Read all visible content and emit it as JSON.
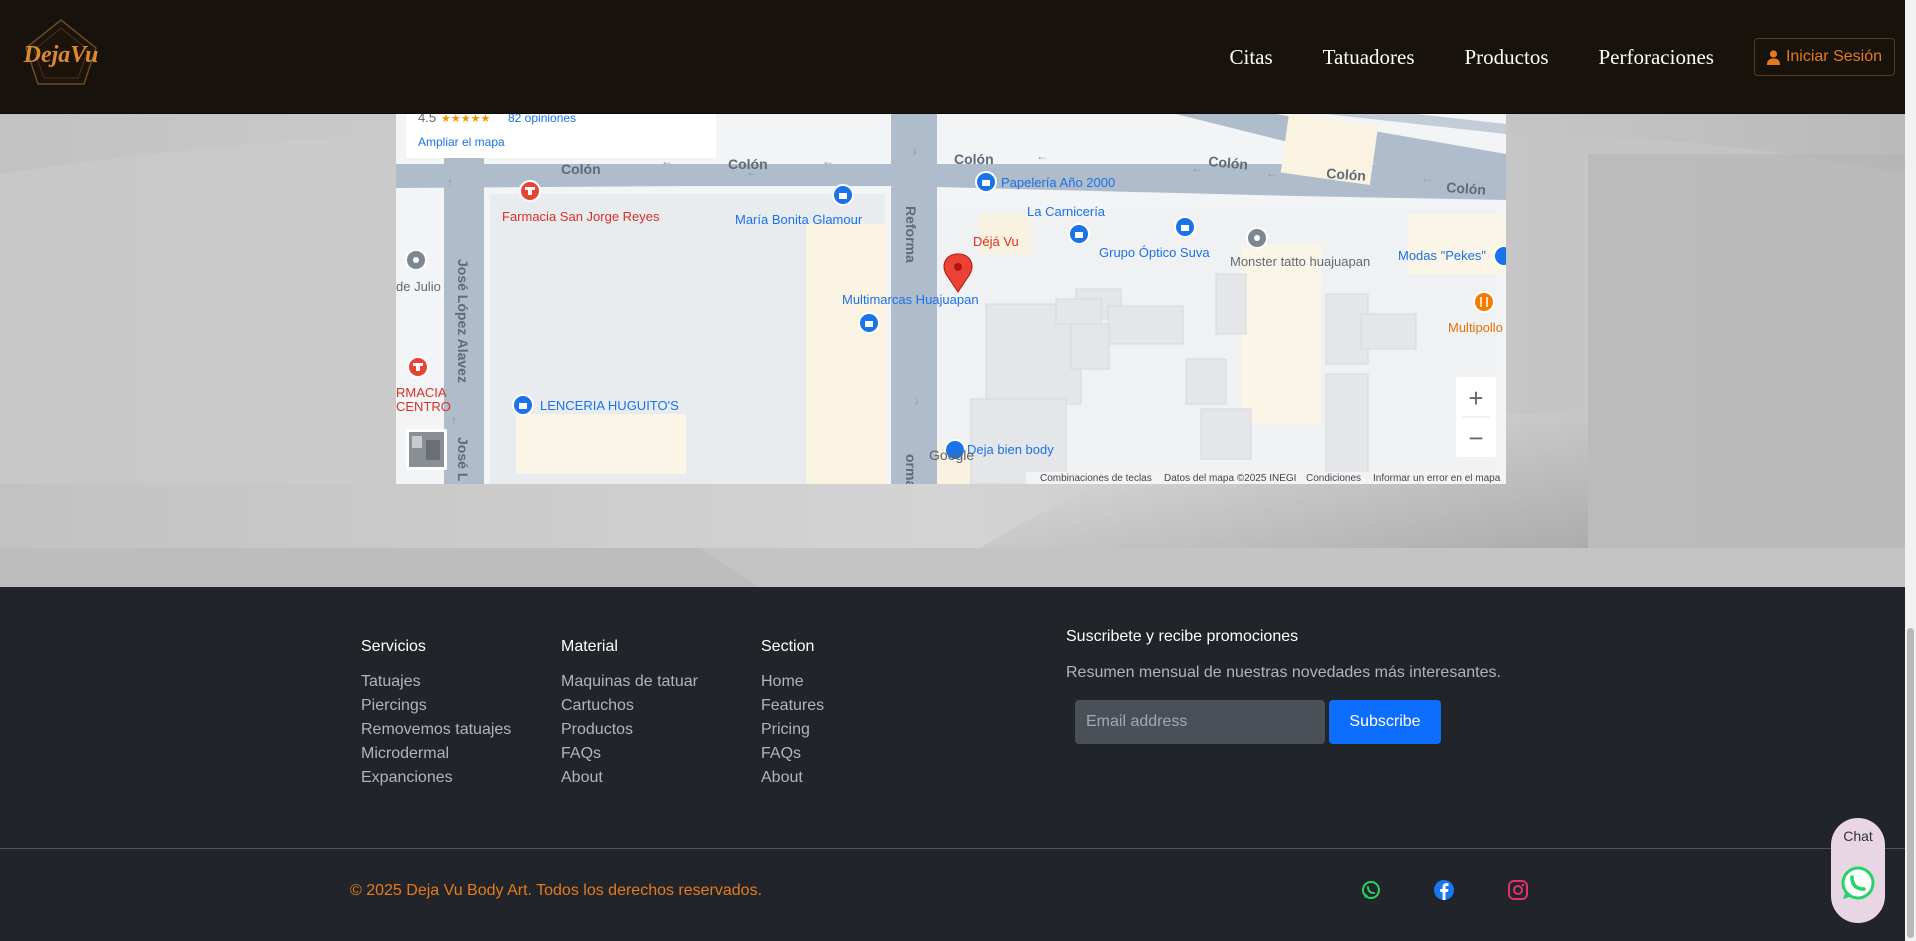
{
  "brand": {
    "logo_text": "DejaVu"
  },
  "nav": {
    "links": [
      "Citas",
      "Tatuadores",
      "Productos",
      "Perforaciones"
    ],
    "login_label": "Iniciar Sesión"
  },
  "map": {
    "info_rating": "4.5",
    "info_reviews": "82 opiniones",
    "info_enlarge": "Ampliar el mapa",
    "streets": {
      "colon": "Colón",
      "reforma": "Reforma",
      "jose_lopez": "José López Alavez",
      "jose_l": "José L",
      "de_julio": "de Julio",
      "reforma2": "orma"
    },
    "places": {
      "farmacia_sjr": "Farmacia San Jorge Reyes",
      "maria_bonita": "María Bonita Glamour",
      "papeleria": "Papelería Año 2000",
      "carniceria": "La Carnicería",
      "deja_vu": "Déjá Vu",
      "grupo_optico": "Grupo Óptico Suva",
      "monster": "Monster tatto huajuapan",
      "modas": "Modas \"Pekes\"",
      "multimarcas": "Multimarcas Huajuapan",
      "multipollo": "Multipollo",
      "farmacia_centro_1": "RMACIA",
      "farmacia_centro_2": "CENTRO",
      "lenceria": "LENCERIA HUGUITO'S",
      "deja_bien": "Deja bien body"
    },
    "google": "Google",
    "attribution": {
      "shortcuts": "Combinaciones de teclas",
      "data": "Datos del mapa ©2025 INEGI",
      "terms": "Condiciones",
      "report": "Informar un error en el mapa"
    },
    "zoom_in": "+",
    "zoom_out": "−"
  },
  "footer": {
    "columns": [
      {
        "title": "Servicios",
        "links": [
          "Tatuajes",
          "Piercings",
          "Removemos tatuajes",
          "Microdermal",
          "Expanciones"
        ]
      },
      {
        "title": "Material",
        "links": [
          "Maquinas de tatuar",
          "Cartuchos",
          "Productos",
          "FAQs",
          "About"
        ]
      },
      {
        "title": "Section",
        "links": [
          "Home",
          "Features",
          "Pricing",
          "FAQs",
          "About"
        ]
      }
    ],
    "newsletter": {
      "title": "Suscribete y recibe promociones",
      "description": "Resumen mensual de nuestras novedades más interesantes.",
      "placeholder": "Email address",
      "button": "Subscribe"
    },
    "copyright": "© 2025 Deja Vu Body Art. Todos los derechos reservados.",
    "social": [
      "whatsapp-icon",
      "facebook-icon",
      "instagram-icon"
    ]
  },
  "chat": {
    "label": "Chat"
  },
  "colors": {
    "accent": "#e47a1e",
    "navbar": "#17120c",
    "footer": "#212529",
    "primary": "#0d6efd",
    "whatsapp": "#25d366",
    "facebook": "#1877f2",
    "instagram": "#e1306c"
  }
}
